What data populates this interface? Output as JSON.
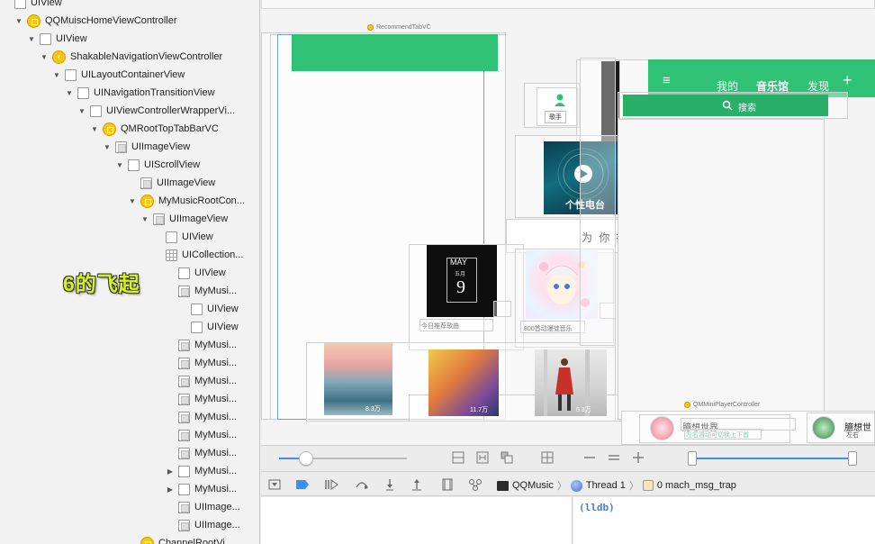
{
  "tree": {
    "overlay_text": "6的飞起",
    "rows": [
      {
        "label": "UIView",
        "depth": 0,
        "arrow": "none",
        "icon": "view"
      },
      {
        "label": "QQMuiscHomeViewController",
        "depth": 1,
        "arrow": "down",
        "icon": "vc"
      },
      {
        "label": "UIView",
        "depth": 2,
        "arrow": "down",
        "icon": "view"
      },
      {
        "label": "ShakableNavigationViewController",
        "depth": 3,
        "arrow": "down",
        "icon": "nav"
      },
      {
        "label": "UILayoutContainerView",
        "depth": 4,
        "arrow": "down",
        "icon": "view"
      },
      {
        "label": "UINavigationTransitionView",
        "depth": 5,
        "arrow": "down",
        "icon": "view"
      },
      {
        "label": "UIViewControllerWrapperVi...",
        "depth": 6,
        "arrow": "down",
        "icon": "view"
      },
      {
        "label": "QMRootTopTabBarVC",
        "depth": 7,
        "arrow": "down",
        "icon": "vc"
      },
      {
        "label": "UIImageView",
        "depth": 8,
        "arrow": "down",
        "icon": "img"
      },
      {
        "label": "UIScrollView",
        "depth": 9,
        "arrow": "down",
        "icon": "view"
      },
      {
        "label": "UIImageView",
        "depth": 10,
        "arrow": "none",
        "icon": "img"
      },
      {
        "label": "MyMusicRootCon...",
        "depth": 10,
        "arrow": "down",
        "icon": "vc"
      },
      {
        "label": "UIImageView",
        "depth": 11,
        "arrow": "down",
        "icon": "img"
      },
      {
        "label": "UIView",
        "depth": 12,
        "arrow": "none",
        "icon": "view"
      },
      {
        "label": "UICollection...",
        "depth": 12,
        "arrow": "none",
        "icon": "grid"
      },
      {
        "label": "UIView",
        "depth": 13,
        "arrow": "none",
        "icon": "view"
      },
      {
        "label": "MyMusi...",
        "depth": 13,
        "arrow": "none",
        "icon": "img"
      },
      {
        "label": "UIView",
        "depth": 14,
        "arrow": "none",
        "icon": "view"
      },
      {
        "label": "UIView",
        "depth": 14,
        "arrow": "none",
        "icon": "view"
      },
      {
        "label": "MyMusi...",
        "depth": 13,
        "arrow": "none",
        "icon": "img"
      },
      {
        "label": "MyMusi...",
        "depth": 13,
        "arrow": "none",
        "icon": "img"
      },
      {
        "label": "MyMusi...",
        "depth": 13,
        "arrow": "none",
        "icon": "img"
      },
      {
        "label": "MyMusi...",
        "depth": 13,
        "arrow": "none",
        "icon": "img"
      },
      {
        "label": "MyMusi...",
        "depth": 13,
        "arrow": "none",
        "icon": "img"
      },
      {
        "label": "MyMusi...",
        "depth": 13,
        "arrow": "none",
        "icon": "img"
      },
      {
        "label": "MyMusi...",
        "depth": 13,
        "arrow": "none",
        "icon": "img"
      },
      {
        "label": "MyMusi...",
        "depth": 13,
        "arrow": "right",
        "icon": "view"
      },
      {
        "label": "MyMusi...",
        "depth": 13,
        "arrow": "right",
        "icon": "view"
      },
      {
        "label": "UIImage...",
        "depth": 13,
        "arrow": "none",
        "icon": "img"
      },
      {
        "label": "UIImage...",
        "depth": 13,
        "arrow": "none",
        "icon": "img"
      },
      {
        "label": "ChannelRootVi...",
        "depth": 10,
        "arrow": "none",
        "icon": "vc"
      }
    ]
  },
  "canvas": {
    "recommend_label": "RecommendTabVC",
    "mini_player_label": "QMMiniPlayerController",
    "nav_tabs": [
      "我的",
      "音乐馆",
      "发现"
    ],
    "menu_icon": "≡",
    "plus_icon": "+",
    "search_label": "搜索",
    "singer_label": "歌手",
    "radio_label": "个性电台",
    "recommend_header": "为 你 推",
    "calendar_month": "MAY",
    "calendar_sub": "五月",
    "calendar_day": "9",
    "daily_caption": "今日推荐歌曲",
    "anime_caption": "800首动漫徒音乐",
    "play_counts": [
      "8.3万",
      "11.7万",
      "5.3万"
    ],
    "song_title": "臆想世界",
    "song_hint": "左右滑动可切换上下首",
    "song_title_2": "臆想世",
    "song_hint_2": "左右"
  },
  "debug": {
    "app": "QQMusic",
    "thread": "Thread 1",
    "frame": "0 mach_msg_trap",
    "prompt": "(lldb)"
  }
}
